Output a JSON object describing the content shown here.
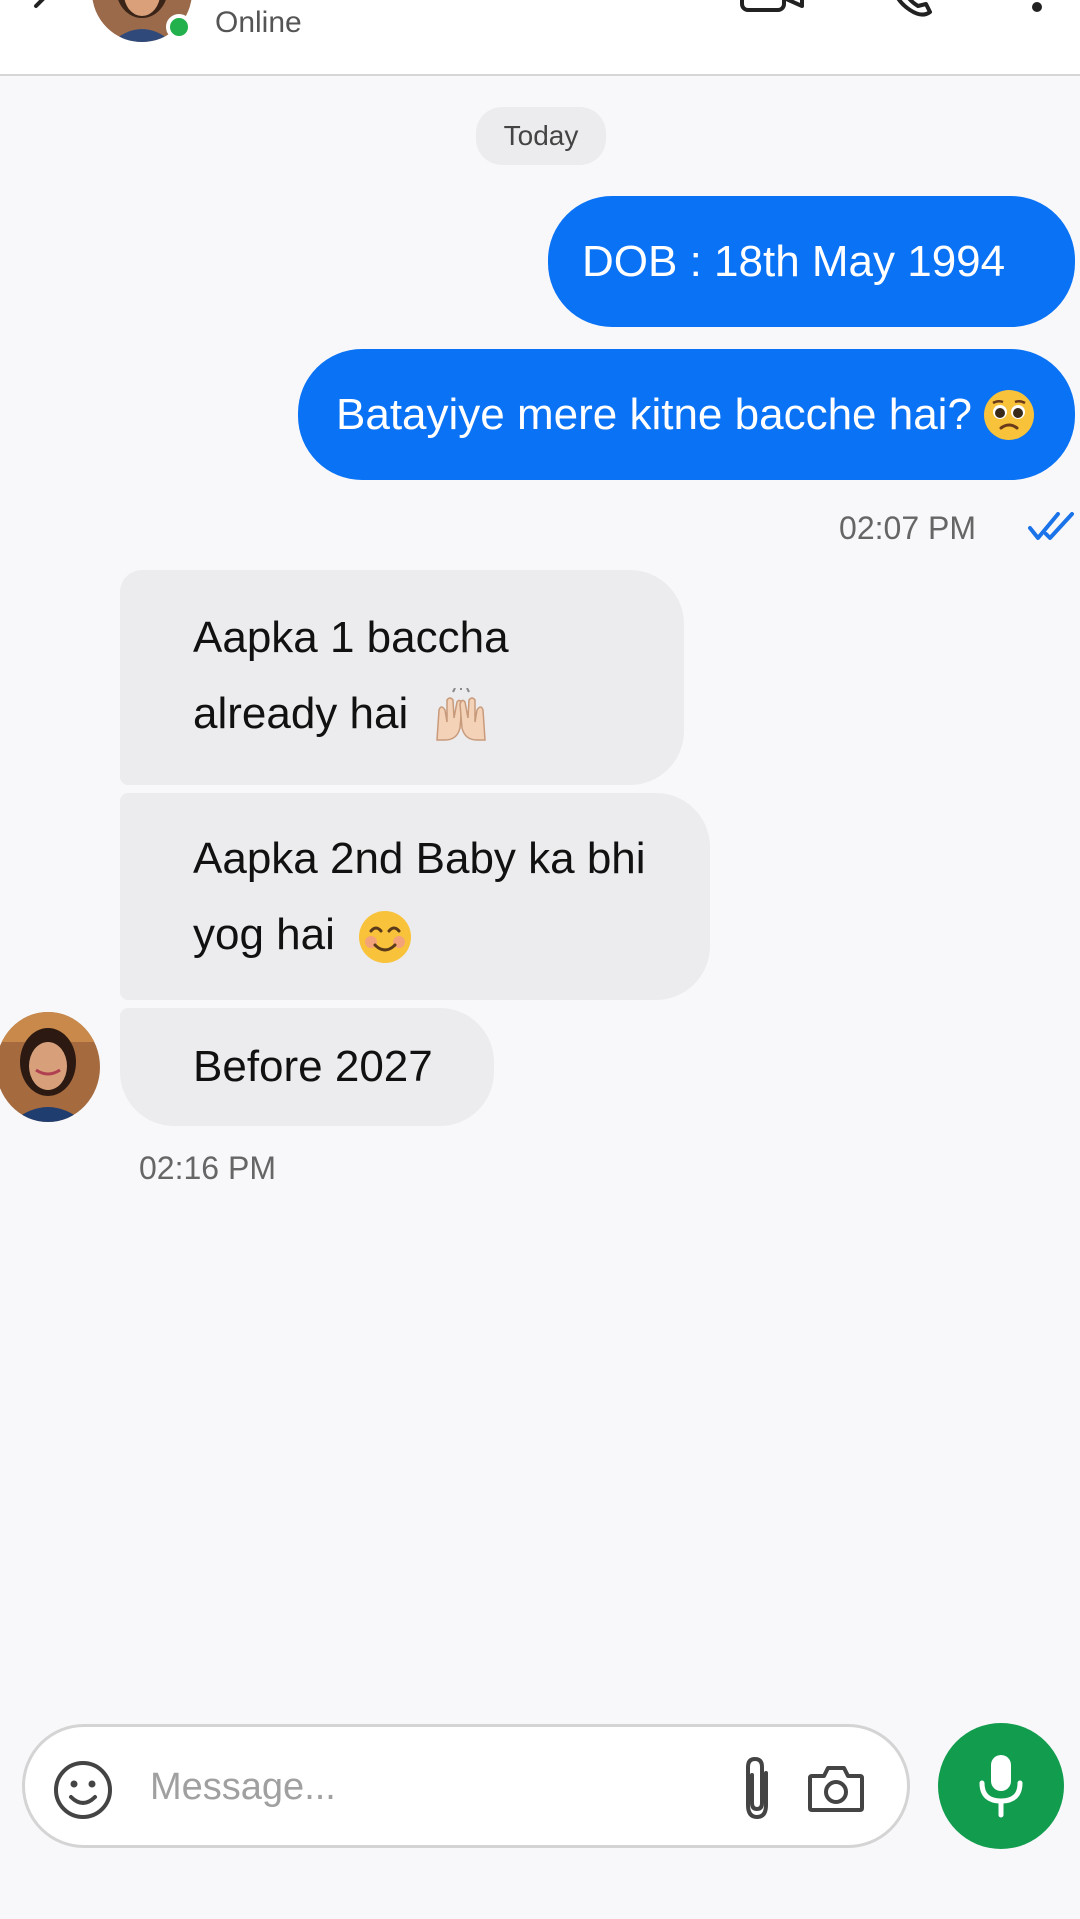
{
  "header": {
    "status": "Online",
    "icons": {
      "back": "back-arrow-icon",
      "video": "video-call-icon",
      "call": "phone-call-icon",
      "more": "more-vert-icon"
    }
  },
  "chat": {
    "date_label": "Today",
    "outgoing": [
      {
        "text": "DOB : 18th May 1994"
      },
      {
        "text": "Batayiye mere kitne bacche hai?",
        "emoji": "pleading-face"
      }
    ],
    "outgoing_time": "02:07 PM",
    "outgoing_status": "read",
    "incoming": [
      {
        "line1": "Aapka 1 baccha",
        "line2": "already hai",
        "emoji": "raising-hands"
      },
      {
        "line1": "Aapka 2nd Baby ka bhi",
        "line2": "yog hai",
        "emoji": "smiling-face-with-smiling-eyes"
      },
      {
        "line1": "Before 2027"
      }
    ],
    "incoming_time": "02:16 PM"
  },
  "composer": {
    "placeholder": "Message...",
    "icons": {
      "emoji": "emoji-icon",
      "attach": "attach-icon",
      "camera": "camera-icon",
      "mic": "mic-icon"
    }
  },
  "colors": {
    "outgoing_bubble": "#0a72f5",
    "incoming_bubble": "#ececee",
    "mic_button": "#129c4e",
    "online_dot": "#22b14c",
    "read_ticks": "#1a73e8"
  }
}
